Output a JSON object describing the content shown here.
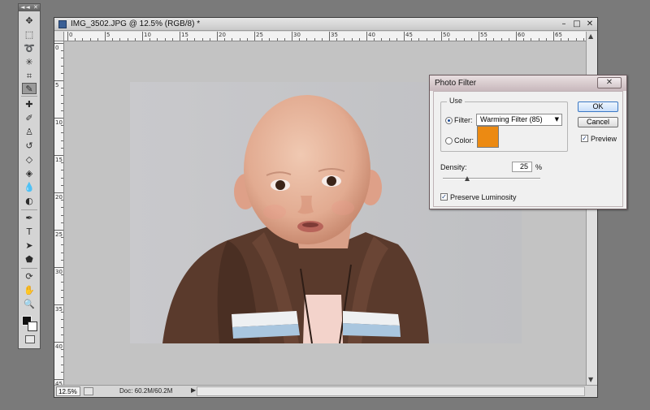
{
  "tools_panel": {
    "collapse_label": "◄◄ ✕",
    "selected_tool": "eyedropper-tool",
    "foreground_color": "#111111",
    "background_color": "#ffffff"
  },
  "document": {
    "title": "IMG_3502.JPG @ 12.5% (RGB/8) *",
    "window_buttons": [
      "–",
      "□",
      "✕"
    ],
    "ruler_top_labels": [
      "0",
      "5",
      "10",
      "15",
      "20",
      "25",
      "30",
      "35",
      "40",
      "45",
      "50",
      "55",
      "60",
      "65"
    ],
    "ruler_left_labels": [
      "0",
      "5",
      "10",
      "15",
      "20",
      "25",
      "30",
      "35",
      "40",
      "45"
    ],
    "status": {
      "zoom": "12.5%",
      "doc_info": "Doc: 60.2M/60.2M"
    }
  },
  "dialog": {
    "title": "Photo Filter",
    "close_label": "✕",
    "use_legend": "Use",
    "filter_label": "Filter:",
    "filter_selected": true,
    "filter_value": "Warming Filter (85)",
    "color_label": "Color:",
    "color_selected": false,
    "color_swatch": "#ec8a12",
    "ok_label": "OK",
    "cancel_label": "Cancel",
    "preview_label": "Preview",
    "preview_checked": true,
    "density_label": "Density:",
    "density_value": "25",
    "density_unit": "%",
    "density_fraction": 0.25,
    "preserve_label": "Preserve Luminosity",
    "preserve_checked": true
  }
}
